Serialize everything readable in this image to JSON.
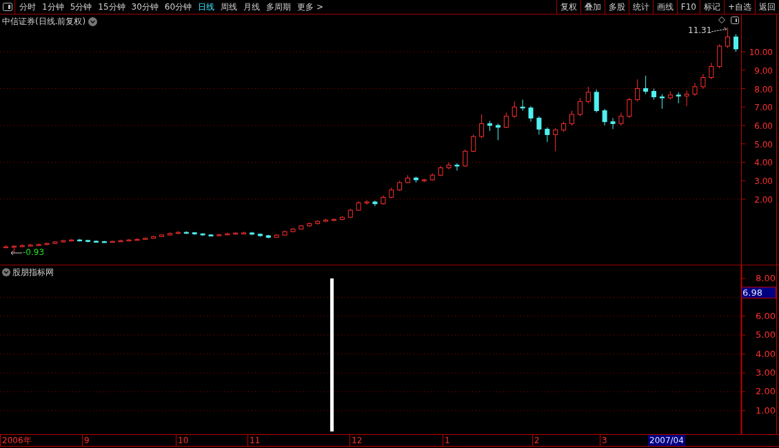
{
  "toolbar": {
    "periods": [
      {
        "label": "分时",
        "selected": false
      },
      {
        "label": "1分钟",
        "selected": false
      },
      {
        "label": "5分钟",
        "selected": false
      },
      {
        "label": "15分钟",
        "selected": false
      },
      {
        "label": "30分钟",
        "selected": false
      },
      {
        "label": "60分钟",
        "selected": false
      },
      {
        "label": "日线",
        "selected": true
      },
      {
        "label": "周线",
        "selected": false
      },
      {
        "label": "月线",
        "selected": false
      },
      {
        "label": "多周期",
        "selected": false
      },
      {
        "label": "更多 >",
        "selected": false
      }
    ],
    "actions": [
      "复权",
      "叠加",
      "多股",
      "统计",
      "画线",
      "F10",
      "标记",
      "+自选",
      "返回"
    ]
  },
  "main_chart": {
    "title": "中信证券(日线.前复权)",
    "high_label": "11.31",
    "low_label": "-0.93",
    "chart_data": {
      "type": "candlestick",
      "grid": true,
      "ylim": [
        -1.59,
        12.02
      ],
      "yticks": [
        {
          "value": 10,
          "label": "10.00"
        },
        {
          "value": 9,
          "label": "9.00"
        },
        {
          "value": 8,
          "label": "8.00"
        },
        {
          "value": 7,
          "label": "7.00"
        },
        {
          "value": 6,
          "label": "6.00"
        },
        {
          "value": 5,
          "label": "5.00"
        },
        {
          "value": 4,
          "label": "4.00"
        },
        {
          "value": 3,
          "label": "3.00"
        },
        {
          "value": 2,
          "label": "2.00"
        }
      ],
      "ohlc": [
        [
          -0.62,
          -0.5,
          -0.66,
          -0.58
        ],
        [
          -0.58,
          -0.5,
          -0.93,
          -0.55
        ],
        [
          -0.55,
          -0.45,
          -0.6,
          -0.52
        ],
        [
          -0.52,
          -0.42,
          -0.56,
          -0.49
        ],
        [
          -0.49,
          -0.4,
          -0.52,
          -0.46
        ],
        [
          -0.46,
          -0.36,
          -0.5,
          -0.4
        ],
        [
          -0.4,
          -0.28,
          -0.44,
          -0.32
        ],
        [
          -0.32,
          -0.2,
          -0.36,
          -0.25
        ],
        [
          -0.25,
          -0.16,
          -0.3,
          -0.21
        ],
        [
          -0.21,
          -0.16,
          -0.3,
          -0.24
        ],
        [
          -0.24,
          -0.2,
          -0.34,
          -0.28
        ],
        [
          -0.28,
          -0.24,
          -0.36,
          -0.3
        ],
        [
          -0.3,
          -0.26,
          -0.36,
          -0.31
        ],
        [
          -0.31,
          -0.25,
          -0.35,
          -0.29
        ],
        [
          -0.29,
          -0.2,
          -0.33,
          -0.25
        ],
        [
          -0.25,
          -0.16,
          -0.28,
          -0.21
        ],
        [
          -0.21,
          -0.12,
          -0.25,
          -0.18
        ],
        [
          -0.18,
          -0.08,
          -0.22,
          -0.12
        ],
        [
          -0.12,
          0.02,
          -0.15,
          -0.03
        ],
        [
          -0.03,
          0.1,
          -0.06,
          0.06
        ],
        [
          0.06,
          0.2,
          0.02,
          0.14
        ],
        [
          0.14,
          0.26,
          0.1,
          0.2
        ],
        [
          0.2,
          0.26,
          0.12,
          0.18
        ],
        [
          0.18,
          0.22,
          0.06,
          0.12
        ],
        [
          0.12,
          0.16,
          0.0,
          0.06
        ],
        [
          0.06,
          0.1,
          -0.02,
          0.03
        ],
        [
          0.03,
          0.12,
          0.0,
          0.07
        ],
        [
          0.07,
          0.18,
          0.04,
          0.12
        ],
        [
          0.12,
          0.22,
          0.08,
          0.16
        ],
        [
          0.16,
          0.24,
          0.1,
          0.17
        ],
        [
          0.17,
          0.22,
          0.04,
          0.1
        ],
        [
          0.1,
          0.14,
          -0.04,
          0.02
        ],
        [
          0.02,
          0.06,
          -0.12,
          -0.07
        ],
        [
          -0.07,
          0.1,
          -0.1,
          0.05
        ],
        [
          0.05,
          0.3,
          0.02,
          0.24
        ],
        [
          0.24,
          0.44,
          0.2,
          0.38
        ],
        [
          0.38,
          0.6,
          0.34,
          0.55
        ],
        [
          0.55,
          0.74,
          0.5,
          0.68
        ],
        [
          0.68,
          0.86,
          0.62,
          0.8
        ],
        [
          0.8,
          0.94,
          0.76,
          0.87
        ],
        [
          0.87,
          0.96,
          0.8,
          0.9
        ],
        [
          0.9,
          1.08,
          0.86,
          1.02
        ],
        [
          1.02,
          1.48,
          0.98,
          1.4
        ],
        [
          1.4,
          1.9,
          1.36,
          1.8
        ],
        [
          1.8,
          1.95,
          1.7,
          1.85
        ],
        [
          1.85,
          1.92,
          1.62,
          1.75
        ],
        [
          1.75,
          2.2,
          1.7,
          2.1
        ],
        [
          2.1,
          2.62,
          2.05,
          2.5
        ],
        [
          2.5,
          3.0,
          2.44,
          2.9
        ],
        [
          2.9,
          3.3,
          2.86,
          3.15
        ],
        [
          3.15,
          3.22,
          2.9,
          3.05
        ],
        [
          3.05,
          3.12,
          2.92,
          3.05
        ],
        [
          3.05,
          3.4,
          3.0,
          3.3
        ],
        [
          3.3,
          3.8,
          3.25,
          3.7
        ],
        [
          3.7,
          4.0,
          3.62,
          3.85
        ],
        [
          3.85,
          3.95,
          3.55,
          3.8
        ],
        [
          3.8,
          4.7,
          3.75,
          4.6
        ],
        [
          4.6,
          5.5,
          4.55,
          5.4
        ],
        [
          5.4,
          6.6,
          5.3,
          6.1
        ],
        [
          6.1,
          6.25,
          5.7,
          6.0
        ],
        [
          6.0,
          6.1,
          5.2,
          5.9
        ],
        [
          5.9,
          6.7,
          5.85,
          6.5
        ],
        [
          6.5,
          7.3,
          6.4,
          7.0
        ],
        [
          7.0,
          7.4,
          6.8,
          6.95
        ],
        [
          6.95,
          7.05,
          6.2,
          6.4
        ],
        [
          6.4,
          6.5,
          5.5,
          5.8
        ],
        [
          5.8,
          5.9,
          5.1,
          5.5
        ],
        [
          5.5,
          5.85,
          4.6,
          5.75
        ],
        [
          5.75,
          6.2,
          5.65,
          6.1
        ],
        [
          6.1,
          6.8,
          6.0,
          6.6
        ],
        [
          6.6,
          7.5,
          6.5,
          7.3
        ],
        [
          7.3,
          8.1,
          7.2,
          7.8
        ],
        [
          7.8,
          7.95,
          6.7,
          6.8
        ],
        [
          6.8,
          6.9,
          6.0,
          6.2
        ],
        [
          6.2,
          6.4,
          5.8,
          6.1
        ],
        [
          6.1,
          6.7,
          6.0,
          6.5
        ],
        [
          6.5,
          7.5,
          6.4,
          7.4
        ],
        [
          7.4,
          8.5,
          7.3,
          8.0
        ],
        [
          8.0,
          8.7,
          7.7,
          7.85
        ],
        [
          7.85,
          8.0,
          7.4,
          7.55
        ],
        [
          7.55,
          7.7,
          6.9,
          7.5
        ],
        [
          7.5,
          7.85,
          7.4,
          7.65
        ],
        [
          7.65,
          7.8,
          7.2,
          7.6
        ],
        [
          7.6,
          7.9,
          7.05,
          7.7
        ],
        [
          7.7,
          8.3,
          7.6,
          8.1
        ],
        [
          8.1,
          8.8,
          8.0,
          8.6
        ],
        [
          8.6,
          9.4,
          8.5,
          9.2
        ],
        [
          9.2,
          10.4,
          9.1,
          10.3
        ],
        [
          10.3,
          11.31,
          10.2,
          10.8
        ],
        [
          10.8,
          10.95,
          10.0,
          10.15
        ]
      ]
    }
  },
  "indicator": {
    "title": "股朋指标网",
    "axis": [
      "8.00",
      "6.00",
      "5.00",
      "4.00",
      "3.00",
      "2.00",
      "1.00"
    ],
    "current_value": "6.98"
  },
  "time_axis": {
    "labels": [
      "2006年",
      "9",
      "10",
      "11",
      "12",
      "1",
      "2",
      "3"
    ],
    "current": "2007/04"
  }
}
